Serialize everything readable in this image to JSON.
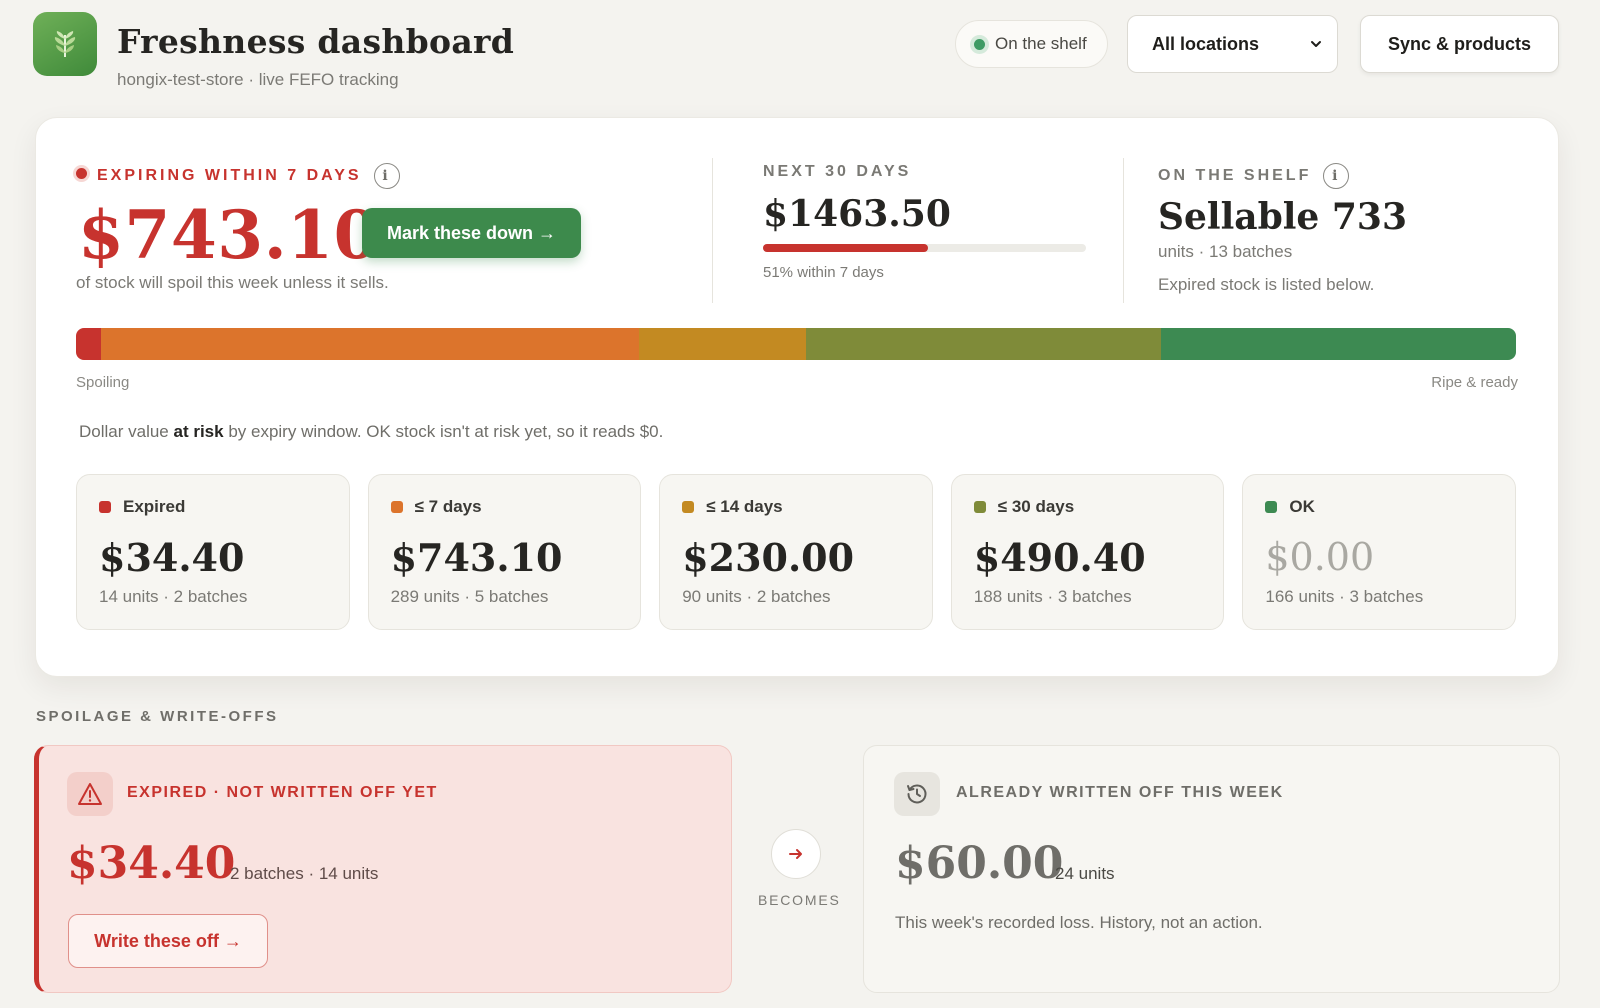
{
  "header": {
    "title": "Freshness dashboard",
    "subtitle": "hongix-test-store · live FEFO tracking",
    "status_label": "On the shelf",
    "location_select": "All locations",
    "sync_label": "Sync & products"
  },
  "kpis": {
    "expiring": {
      "label": "EXPIRING WITHIN 7 DAYS",
      "value": "$743.10",
      "action": "Mark these down →",
      "description": "of stock will spoil this week unless it sells."
    },
    "next30": {
      "label": "NEXT 30 DAYS",
      "value": "$1463.50",
      "progress_fraction": 0.51,
      "note": "51% within 7 days"
    },
    "shelf": {
      "label": "ON THE SHELF",
      "value": "Sellable 733",
      "units": "units · 13 batches",
      "note": "Expired stock is listed below."
    }
  },
  "risk_bar": {
    "left_label": "Spoiling",
    "right_label": "Ripe & ready",
    "segments": [
      {
        "name": "Expired",
        "value": 34.4,
        "color": "#c7332e"
      },
      {
        "name": "≤ 7 days",
        "value": 743.1,
        "color": "#dc742c"
      },
      {
        "name": "≤ 14 days",
        "value": 230.0,
        "color": "#c38a22"
      },
      {
        "name": "≤ 30 days",
        "value": 490.4,
        "color": "#7f8b39"
      },
      {
        "name": "OK",
        "value": 490.4,
        "color": "#3d8a52"
      }
    ]
  },
  "caption": {
    "before": "Dollar value ",
    "bold": "at risk",
    "after": " by expiry window. OK stock isn't at risk yet, so it reads $0."
  },
  "tiles": [
    {
      "label": "Expired",
      "value": "$34.40",
      "meta": "14 units · 2 batches",
      "color": "#c7332e",
      "muted": false
    },
    {
      "label": "≤ 7 days",
      "value": "$743.10",
      "meta": "289 units · 5 batches",
      "color": "#dc742c",
      "muted": false
    },
    {
      "label": "≤ 14 days",
      "value": "$230.00",
      "meta": "90 units · 2 batches",
      "color": "#c38a22",
      "muted": false
    },
    {
      "label": "≤ 30 days",
      "value": "$490.40",
      "meta": "188 units · 3 batches",
      "color": "#7f8b39",
      "muted": false
    },
    {
      "label": "OK",
      "value": "$0.00",
      "meta": "166 units · 3 batches",
      "color": "#3d8a52",
      "muted": true
    }
  ],
  "spoilage": {
    "section_label": "SPOILAGE & WRITE-OFFS",
    "expired": {
      "label": "EXPIRED · NOT WRITTEN OFF YET",
      "value": "$34.40",
      "meta": "2 batches · 14 units",
      "action": "Write these off →"
    },
    "becomes_label": "BECOMES",
    "written": {
      "label": "ALREADY WRITTEN OFF THIS WEEK",
      "value": "$60.00",
      "meta": "24 units",
      "note": "This week's recorded loss. History, not an action."
    }
  }
}
